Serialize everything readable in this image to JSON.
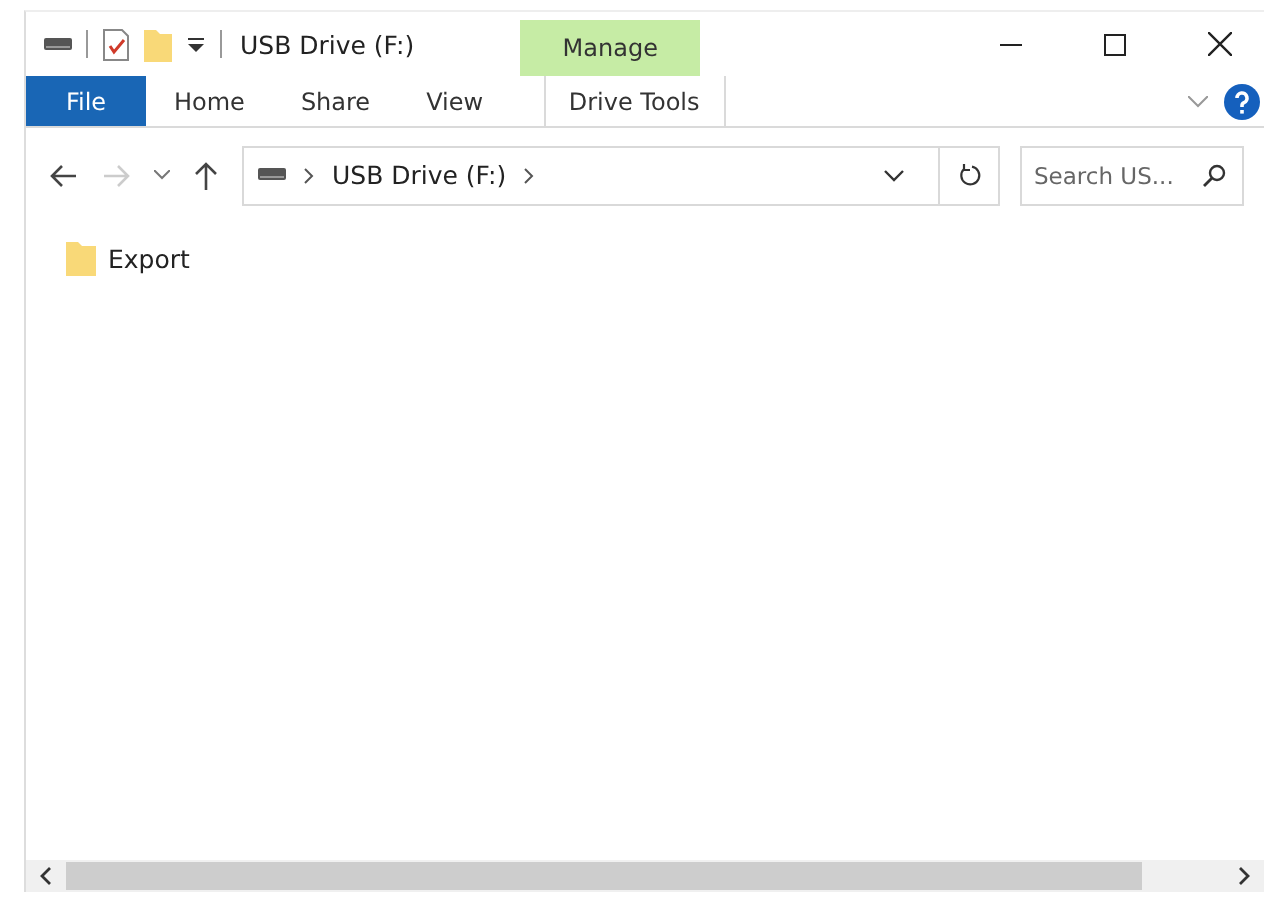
{
  "window": {
    "title": "USB Drive (F:)"
  },
  "ribbon": {
    "context_group": "Manage",
    "tabs": [
      {
        "label": "File",
        "kind": "file",
        "selected": false
      },
      {
        "label": "Home",
        "kind": "tab",
        "selected": false
      },
      {
        "label": "Share",
        "kind": "tab",
        "selected": false
      },
      {
        "label": "View",
        "kind": "tab",
        "selected": false
      },
      {
        "label": "Drive Tools",
        "kind": "context",
        "selected": false
      }
    ]
  },
  "navigation": {
    "back_disabled": false,
    "forward_disabled": true
  },
  "address_bar": {
    "path": [
      "USB Drive (F:)"
    ]
  },
  "search": {
    "placeholder": "Search US..."
  },
  "items": [
    {
      "name": "Export"
    }
  ]
}
